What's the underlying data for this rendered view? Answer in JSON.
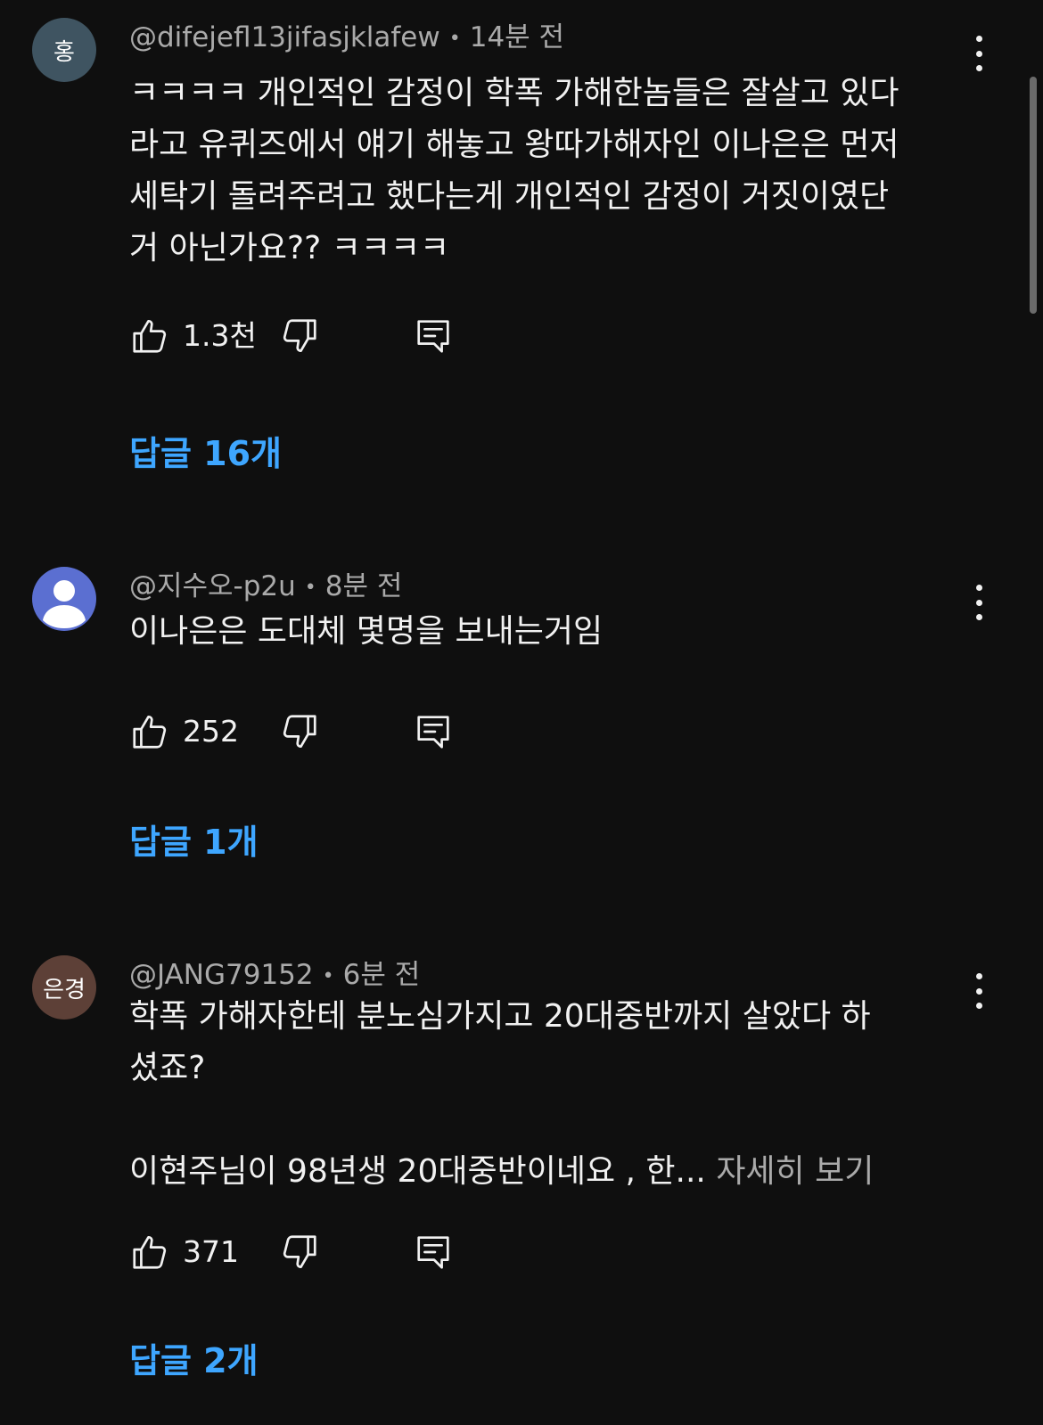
{
  "comments": [
    {
      "avatar_text": "홍",
      "avatar_color": "#3f5461",
      "handle": "@difejefl13jifasjklafew",
      "time": "14분 전",
      "text": "ㅋㅋㅋㅋ 개인적인 감정이 학폭 가해한놈들은 잘살고 있다\n라고 유퀴즈에서 얘기 해놓고 왕따가해자인 이나은은 먼저\n세탁기 돌려주려고 했다는게 개인적인 감정이 거짓이였단\n거 아닌가요?? ㅋㅋㅋㅋ",
      "likes": "1.3천",
      "replies_label": "답글 16개"
    },
    {
      "avatar_icon": "person-icon",
      "avatar_color": "#5b6fd1",
      "handle": "@지수오-p2u",
      "time": "8분 전",
      "text": "이나은은 도대체 몇명을 보내는거임",
      "likes": "252",
      "replies_label": "답글 1개"
    },
    {
      "avatar_text": "은경",
      "avatar_color": "#5d4037",
      "handle": "@JANG79152",
      "time": "6분 전",
      "text": "학폭 가해자한테 분노심가지고 20대중반까지 살았다 하\n셨죠?\n\n이현주님이 98년생 20대중반이네요 , 한...",
      "read_more": "자세히 보기",
      "likes": "371",
      "replies_label": "답글 2개"
    }
  ],
  "colors": {
    "background": "#0f0f0f",
    "text": "#f1f1f1",
    "secondary_text": "#aaaaaa",
    "link_blue": "#3ea6ff"
  },
  "icons": {
    "like": "thumbs-up-icon",
    "dislike": "thumbs-down-icon",
    "reply": "reply-comment-icon",
    "more": "more-vertical-icon"
  }
}
